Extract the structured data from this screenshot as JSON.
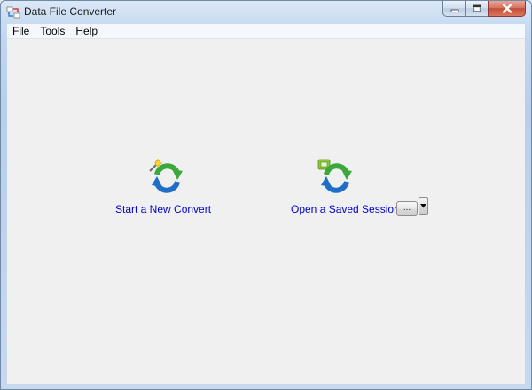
{
  "window": {
    "title": "Data File Converter",
    "icon": "app-converter-icon"
  },
  "caption_buttons": {
    "minimize": "minimize-icon",
    "maximize": "maximize-icon",
    "close": "close-icon"
  },
  "menu": {
    "items": [
      {
        "label": "File"
      },
      {
        "label": "Tools"
      },
      {
        "label": "Help"
      }
    ]
  },
  "actions": {
    "new_convert": {
      "label": "Start a New Convert",
      "icon": "new-convert-icon"
    },
    "open_session": {
      "label": "Open a Saved Session",
      "icon": "open-session-icon",
      "browse_label": "...",
      "dropdown_icon": "triangle-down-icon"
    }
  },
  "colors": {
    "link": "#0000cc",
    "client_bg": "#f0f0f0",
    "arrow_green": "#3aa83a",
    "arrow_blue": "#1f6fc9"
  }
}
